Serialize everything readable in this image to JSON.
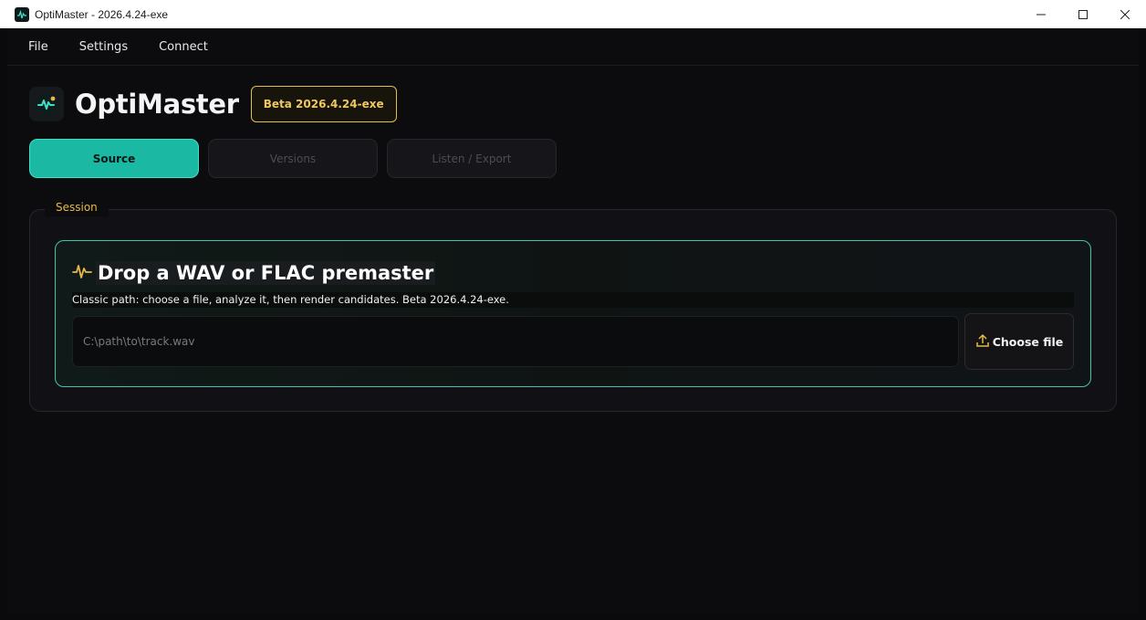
{
  "window": {
    "title": "OptiMaster - 2026.4.24-exe",
    "icon": "waveform-icon",
    "controls": [
      "minimize-icon",
      "maximize-icon",
      "close-icon"
    ]
  },
  "menu": {
    "file": "File",
    "settings": "Settings",
    "connect": "Connect"
  },
  "header": {
    "app_name": "OptiMaster",
    "badge": "Beta 2026.4.24-exe"
  },
  "tabs": [
    {
      "label": "Source",
      "active": true
    },
    {
      "label": "Versions",
      "active": false
    },
    {
      "label": "Listen / Export",
      "active": false
    }
  ],
  "session": {
    "label": "Session",
    "drop_title": "Drop a WAV or FLAC premaster",
    "drop_subtitle": "Classic path: choose a file, analyze it, then render candidates. Beta 2026.4.24-exe.",
    "path_placeholder": "C:\\path\\to\\track.wav",
    "choose_button": "Choose file"
  },
  "colors": {
    "accent_teal": "#1bb9a3",
    "accent_gold": "#e8b94a",
    "background": "#0c0c0f"
  }
}
